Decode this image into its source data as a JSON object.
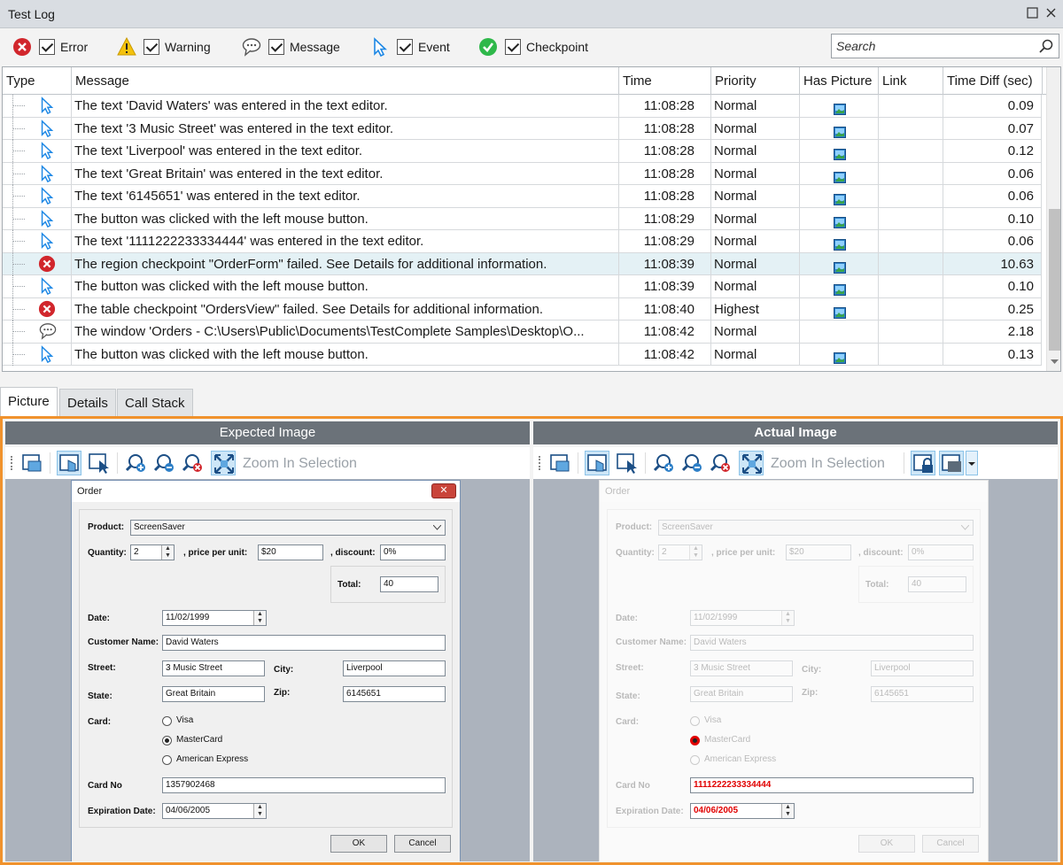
{
  "window": {
    "title": "Test Log"
  },
  "filters": [
    {
      "label": "Error",
      "icon": "error-icon"
    },
    {
      "label": "Warning",
      "icon": "warning-icon"
    },
    {
      "label": "Message",
      "icon": "message-icon"
    },
    {
      "label": "Event",
      "icon": "event-icon"
    },
    {
      "label": "Checkpoint",
      "icon": "checkpoint-icon"
    }
  ],
  "search": {
    "placeholder": "Search"
  },
  "columns": [
    "Type",
    "Message",
    "Time",
    "Priority",
    "Has Picture",
    "Link",
    "Time Diff (sec)"
  ],
  "rows": [
    {
      "type": "event",
      "message": "The text 'David Waters' was entered in the text editor.",
      "time": "11:08:28",
      "priority": "Normal",
      "picture": true,
      "diff": "0.09"
    },
    {
      "type": "event",
      "message": "The text '3 Music Street' was entered in the text editor.",
      "time": "11:08:28",
      "priority": "Normal",
      "picture": true,
      "diff": "0.07"
    },
    {
      "type": "event",
      "message": "The text 'Liverpool' was entered in the text editor.",
      "time": "11:08:28",
      "priority": "Normal",
      "picture": true,
      "diff": "0.12"
    },
    {
      "type": "event",
      "message": "The text 'Great Britain' was entered in the text editor.",
      "time": "11:08:28",
      "priority": "Normal",
      "picture": true,
      "diff": "0.06"
    },
    {
      "type": "event",
      "message": "The text '6145651' was entered in the text editor.",
      "time": "11:08:28",
      "priority": "Normal",
      "picture": true,
      "diff": "0.06"
    },
    {
      "type": "event",
      "message": "The button was clicked with the left mouse button.",
      "time": "11:08:29",
      "priority": "Normal",
      "picture": true,
      "diff": "0.10"
    },
    {
      "type": "event",
      "message": "The text '1111222233334444' was entered in the text editor.",
      "time": "11:08:29",
      "priority": "Normal",
      "picture": true,
      "diff": "0.06"
    },
    {
      "type": "error",
      "message": "The region checkpoint \"OrderForm\" failed. See Details for additional information.",
      "time": "11:08:39",
      "priority": "Normal",
      "picture": true,
      "diff": "10.63",
      "selected": true
    },
    {
      "type": "event",
      "message": "The button was clicked with the left mouse button.",
      "time": "11:08:39",
      "priority": "Normal",
      "picture": true,
      "diff": "0.10"
    },
    {
      "type": "error",
      "message": "The table checkpoint \"OrdersView\" failed. See Details for additional information.",
      "time": "11:08:40",
      "priority": "Highest",
      "picture": true,
      "diff": "0.25"
    },
    {
      "type": "message",
      "message": "The window 'Orders - C:\\Users\\Public\\Documents\\TestComplete Samples\\Desktop\\O...",
      "time": "11:08:42",
      "priority": "Normal",
      "picture": false,
      "diff": "2.18"
    },
    {
      "type": "event",
      "message": "The button was clicked with the left mouse button.",
      "time": "11:08:42",
      "priority": "Normal",
      "picture": true,
      "diff": "0.13"
    }
  ],
  "tabs": [
    "Picture",
    "Details",
    "Call Stack"
  ],
  "expected": {
    "title": "Expected Image",
    "zoom_label": "Zoom In Selection"
  },
  "actual": {
    "title": "Actual Image",
    "zoom_label": "Zoom In Selection"
  },
  "order_form": {
    "title": "Order",
    "product_label": "Product:",
    "product": "ScreenSaver",
    "quantity_label": "Quantity:",
    "quantity": "2",
    "price_label": ", price per unit:",
    "price": "$20",
    "discount_label": ", discount:",
    "discount": "0%",
    "total_label": "Total:",
    "total": "40",
    "date_label": "Date:",
    "date": "11/02/1999",
    "customer_label": "Customer Name:",
    "customer": "David Waters",
    "street_label": "Street:",
    "street": "3 Music Street",
    "city_label": "City:",
    "city": "Liverpool",
    "state_label": "State:",
    "state": "Great Britain",
    "zip_label": "Zip:",
    "zip": "6145651",
    "card_label": "Card:",
    "card_options": [
      "Visa",
      "MasterCard",
      "American Express"
    ],
    "cardno_label": "Card No",
    "cardno": "1357902468",
    "exp_label": "Expiration Date:",
    "exp": "04/06/2005",
    "ok": "OK",
    "cancel": "Cancel"
  },
  "actual_diff": {
    "cardno": "1111222233334444",
    "exp": "04/06/2005"
  }
}
